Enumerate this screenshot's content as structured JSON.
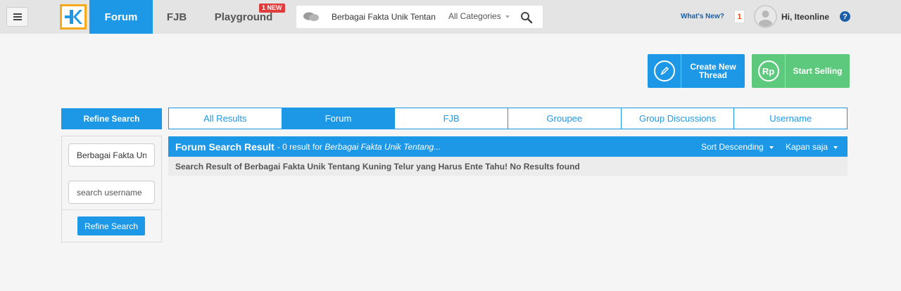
{
  "header": {
    "nav": {
      "forum": "Forum",
      "fjb": "FJB",
      "playground": "Playground",
      "new_badge": "1 NEW"
    },
    "search": {
      "query": "Berbagai Fakta Unik Tentang",
      "category": "All Categories"
    },
    "whats_new": "What's New?",
    "notification_count": "1",
    "greeting": "Hi, Iteonline",
    "help": "?"
  },
  "actions": {
    "create_thread": "Create New Thread",
    "start_selling": "Start Selling",
    "sell_icon_text": "Rp"
  },
  "sidebar": {
    "title": "Refine Search",
    "query_value": "Berbagai Fakta Unik Tentang",
    "username_placeholder": "search username",
    "button": "Refine Search"
  },
  "tabs": [
    {
      "label": "All Results",
      "active": false
    },
    {
      "label": "Forum",
      "active": true
    },
    {
      "label": "FJB",
      "active": false
    },
    {
      "label": "Groupee",
      "active": false
    },
    {
      "label": "Group Discussions",
      "active": false
    },
    {
      "label": "Username",
      "active": false
    }
  ],
  "results": {
    "title": "Forum Search Result",
    "count_text": "- 0 result for",
    "query_snippet": "Berbagai Fakta Unik Tentang...",
    "sort": "Sort Descending",
    "time": "Kapan saja",
    "message": "Search Result of Berbagai Fakta Unik Tentang Kuning Telur yang Harus Ente Tahu! No Results found"
  },
  "colors": {
    "primary": "#1d98e7",
    "sell": "#5cc97d",
    "logo_border": "#f7a81b",
    "badge": "#e13c3c"
  }
}
